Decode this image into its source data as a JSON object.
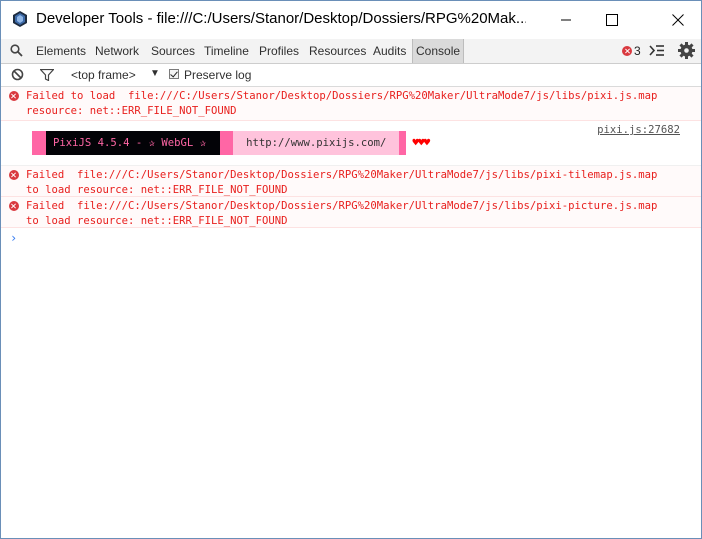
{
  "window": {
    "title": "Developer Tools - file:///C:/Users/Stanor/Desktop/Dossiers/RPG%20Mak...",
    "icons": [
      "devtools-app-icon",
      "minimize-icon",
      "maximize-icon",
      "close-icon"
    ]
  },
  "tabs": [
    {
      "label": "Elements"
    },
    {
      "label": "Network"
    },
    {
      "label": "Sources"
    },
    {
      "label": "Timeline"
    },
    {
      "label": "Profiles"
    },
    {
      "label": "Resources"
    },
    {
      "label": "Audits"
    },
    {
      "label": "Console",
      "selected": true
    }
  ],
  "error_count": "3",
  "toolbar": {
    "frame_label": "<top frame>",
    "preserve_log_label": "Preserve log",
    "preserve_log_checked": true
  },
  "messages": [
    {
      "type": "error",
      "text": "Failed to load  file:///C:/Users/Stanor/Desktop/Dossiers/RPG%20Maker/UltraMode7/js/libs/pixi.js.map\nresource: net::ERR_FILE_NOT_FOUND"
    },
    {
      "type": "log",
      "source": "pixi.js:27682",
      "banner_main": "PixiJS 4.5.4 - ✰ WebGL ✰",
      "banner_url": "http://www.pixijs.com/",
      "hearts": "♥♥♥"
    },
    {
      "type": "error",
      "text": "Failed  file:///C:/Users/Stanor/Desktop/Dossiers/RPG%20Maker/UltraMode7/js/libs/pixi-tilemap.js.map\nto load resource: net::ERR_FILE_NOT_FOUND"
    },
    {
      "type": "error",
      "text": "Failed  file:///C:/Users/Stanor/Desktop/Dossiers/RPG%20Maker/UltraMode7/js/libs/pixi-picture.js.map\nto load resource: net::ERR_FILE_NOT_FOUND"
    }
  ],
  "prompt_symbol": "›",
  "colors": {
    "error_text": "#e8201e",
    "pixi_pink": "#ff66a5",
    "pixi_light_pink": "#ffc3dc",
    "prompt_blue": "#367cf1"
  }
}
